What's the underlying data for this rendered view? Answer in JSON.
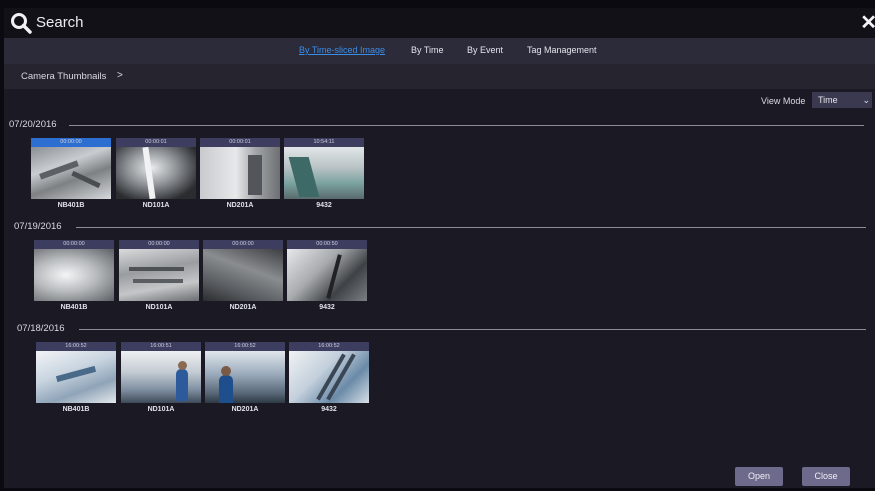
{
  "window": {
    "title": "Search",
    "close_label": "✕"
  },
  "tabs": [
    {
      "label": "By Time-sliced Image",
      "active": true
    },
    {
      "label": "By Time",
      "active": false
    },
    {
      "label": "By Event",
      "active": false
    },
    {
      "label": "Tag Management",
      "active": false
    }
  ],
  "breadcrumb": {
    "label": "Camera Thumbnails",
    "arrow": ">"
  },
  "view_mode": {
    "label": "View Mode",
    "value": "Time"
  },
  "groups": [
    {
      "date": "07/20/2016",
      "thumbnails": [
        {
          "time": "00:00:00",
          "camera": "NB401B",
          "selected": true
        },
        {
          "time": "00:00:01",
          "camera": "ND101A",
          "selected": false
        },
        {
          "time": "00:00:01",
          "camera": "ND201A",
          "selected": false
        },
        {
          "time": "10:54:11",
          "camera": "9432",
          "selected": false
        }
      ]
    },
    {
      "date": "07/19/2016",
      "thumbnails": [
        {
          "time": "00:00:00",
          "camera": "NB401B",
          "selected": false
        },
        {
          "time": "00:00:00",
          "camera": "ND101A",
          "selected": false
        },
        {
          "time": "00:00:00",
          "camera": "ND201A",
          "selected": false
        },
        {
          "time": "00:00:50",
          "camera": "9432",
          "selected": false
        }
      ]
    },
    {
      "date": "07/18/2016",
      "thumbnails": [
        {
          "time": "16:00:52",
          "camera": "NB401B",
          "selected": false
        },
        {
          "time": "16:00:51",
          "camera": "ND101A",
          "selected": false
        },
        {
          "time": "16:00:52",
          "camera": "ND201A",
          "selected": false
        },
        {
          "time": "16:00:52",
          "camera": "9432",
          "selected": false
        }
      ]
    }
  ],
  "buttons": {
    "open": "Open",
    "close": "Close"
  },
  "colors": {
    "accent": "#3a8de6",
    "selected_timestamp": "#2d6fd0",
    "button": "#6e6a8c"
  }
}
